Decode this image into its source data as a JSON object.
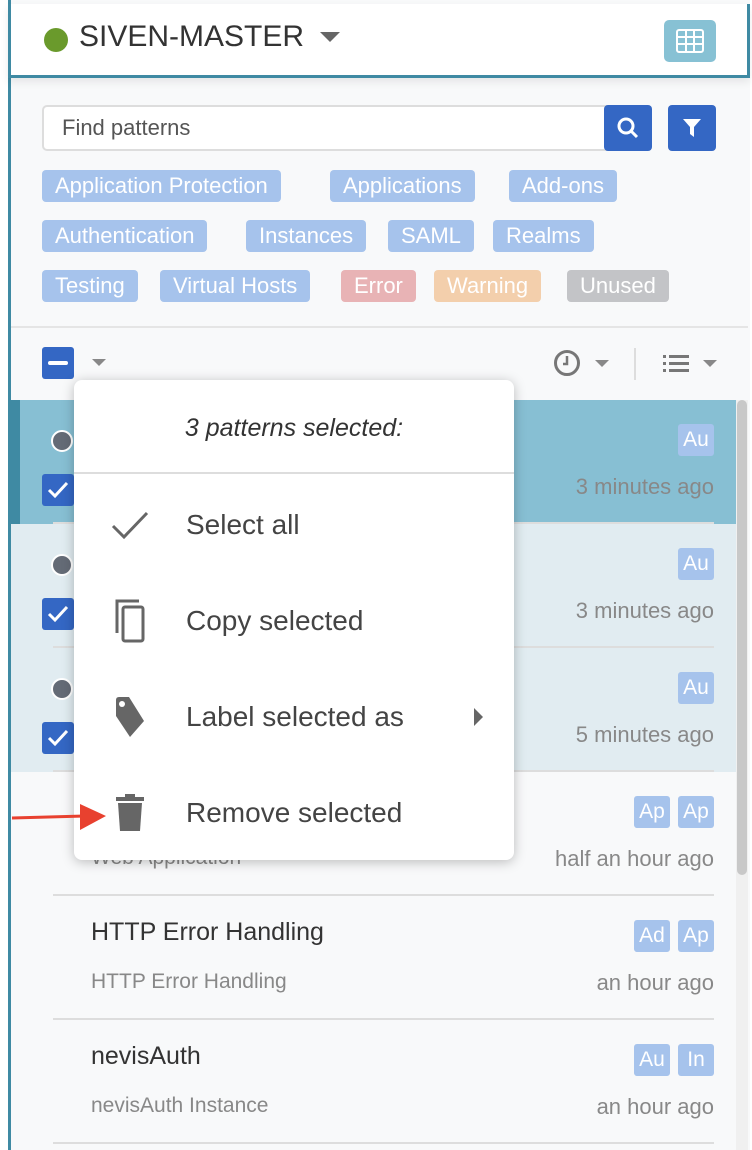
{
  "header": {
    "title": "SIVEN-MASTER",
    "status_color": "#6a9a2c",
    "grid_icon": "grid-icon"
  },
  "search": {
    "placeholder": "Find patterns",
    "value": ""
  },
  "tags": [
    {
      "label": "Application Protection",
      "color": "#a6c3ec"
    },
    {
      "label": "Applications",
      "color": "#a6c3ec"
    },
    {
      "label": "Add-ons",
      "color": "#a6c3ec"
    },
    {
      "label": "Authentication",
      "color": "#a6c3ec"
    },
    {
      "label": "Instances",
      "color": "#a6c3ec"
    },
    {
      "label": "SAML",
      "color": "#a6c3ec"
    },
    {
      "label": "Realms",
      "color": "#a6c3ec"
    },
    {
      "label": "Testing",
      "color": "#a6c3ec"
    },
    {
      "label": "Virtual Hosts",
      "color": "#a6c3ec"
    },
    {
      "label": "Error",
      "color": "#e8b3b5"
    },
    {
      "label": "Warning",
      "color": "#f3cfac"
    },
    {
      "label": "Unused",
      "color": "#c3c4c7"
    }
  ],
  "menu": {
    "header": "3 patterns selected:",
    "items": [
      {
        "label": "Select all",
        "icon": "check-icon"
      },
      {
        "label": "Copy selected",
        "icon": "copy-icon"
      },
      {
        "label": "Label selected as",
        "icon": "tag-icon"
      },
      {
        "label": "Remove selected",
        "icon": "trash-icon"
      }
    ]
  },
  "patterns": [
    {
      "title": "",
      "subtitle": "",
      "chips": [
        "Au"
      ],
      "time": "3 minutes ago",
      "selected": true
    },
    {
      "title": "",
      "subtitle": "",
      "chips": [
        "Au"
      ],
      "time": "3 minutes ago",
      "selected": true
    },
    {
      "title": "",
      "subtitle": "",
      "chips": [
        "Au"
      ],
      "time": "5 minutes ago",
      "selected": true
    },
    {
      "title": "",
      "subtitle": "Web Application",
      "chips": [
        "Ap",
        "Ap"
      ],
      "time": "half an hour ago",
      "selected": false
    },
    {
      "title": "HTTP Error Handling",
      "subtitle": "HTTP Error Handling",
      "chips": [
        "Ad",
        "Ap"
      ],
      "time": "an hour ago",
      "selected": false
    },
    {
      "title": "nevisAuth",
      "subtitle": "nevisAuth Instance",
      "chips": [
        "Au",
        "In"
      ],
      "time": "an hour ago",
      "selected": false
    }
  ]
}
